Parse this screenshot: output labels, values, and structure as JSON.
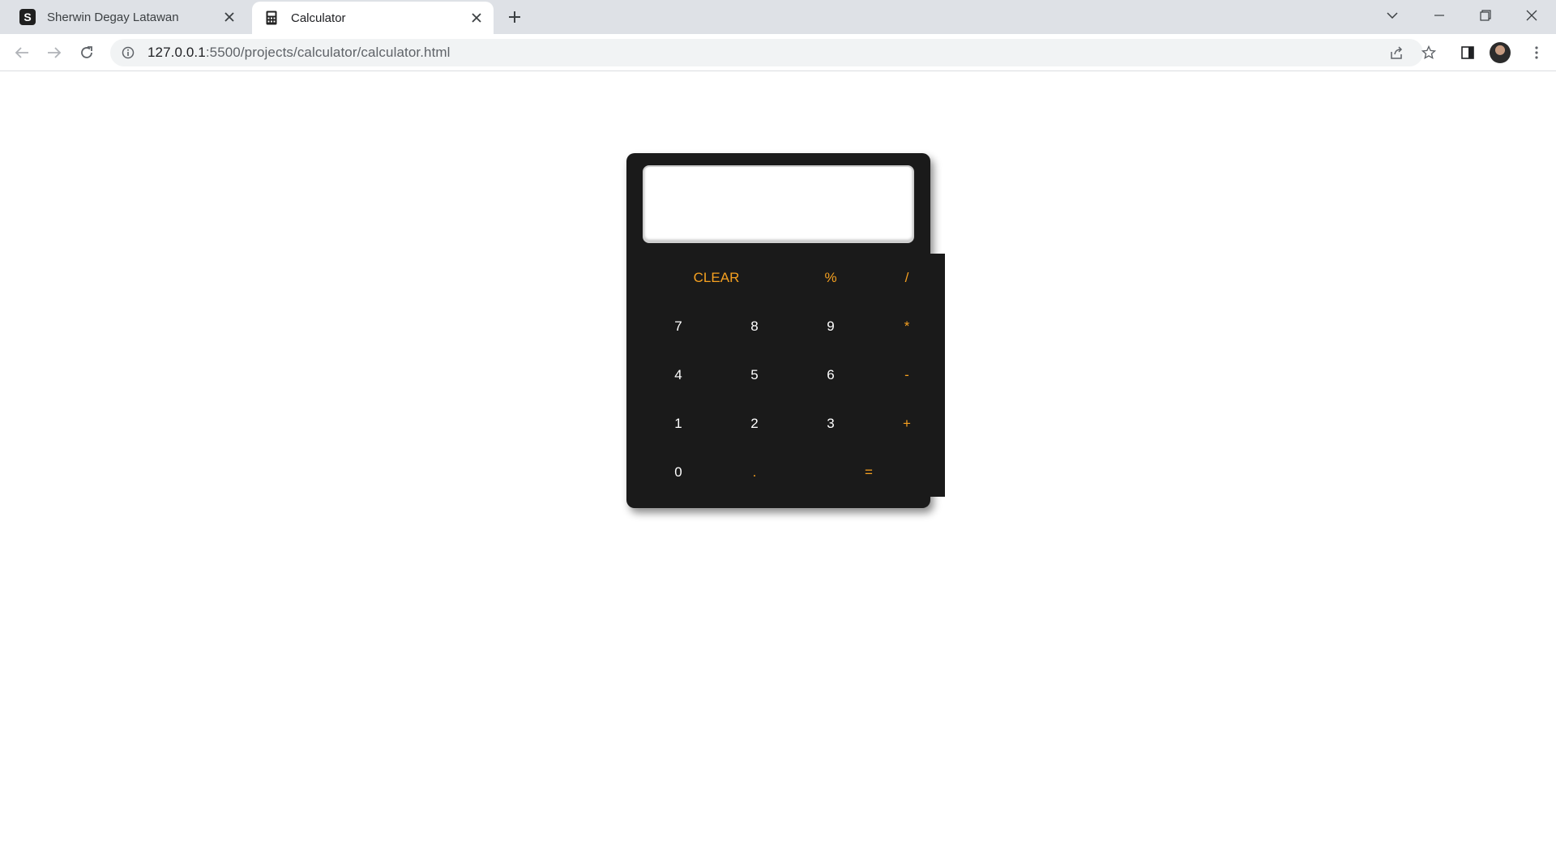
{
  "browser": {
    "tabs": [
      {
        "title": "Sherwin Degay Latawan",
        "favicon": "S",
        "active": false
      },
      {
        "title": "Calculator",
        "favicon": "calculator-icon",
        "active": true
      }
    ],
    "url_host": "127.0.0.1",
    "url_rest": ":5500/projects/calculator/calculator.html"
  },
  "calculator": {
    "display": "",
    "colors": {
      "body": "#1a1a1a",
      "digit": "#ffffff",
      "operator": "#f5a020"
    },
    "keys": {
      "clear": "CLEAR",
      "percent": "%",
      "divide": "/",
      "seven": "7",
      "eight": "8",
      "nine": "9",
      "multiply": "*",
      "four": "4",
      "five": "5",
      "six": "6",
      "minus": "-",
      "one": "1",
      "two": "2",
      "three": "3",
      "plus": "+",
      "zero": "0",
      "dot": ".",
      "equals": "="
    }
  }
}
